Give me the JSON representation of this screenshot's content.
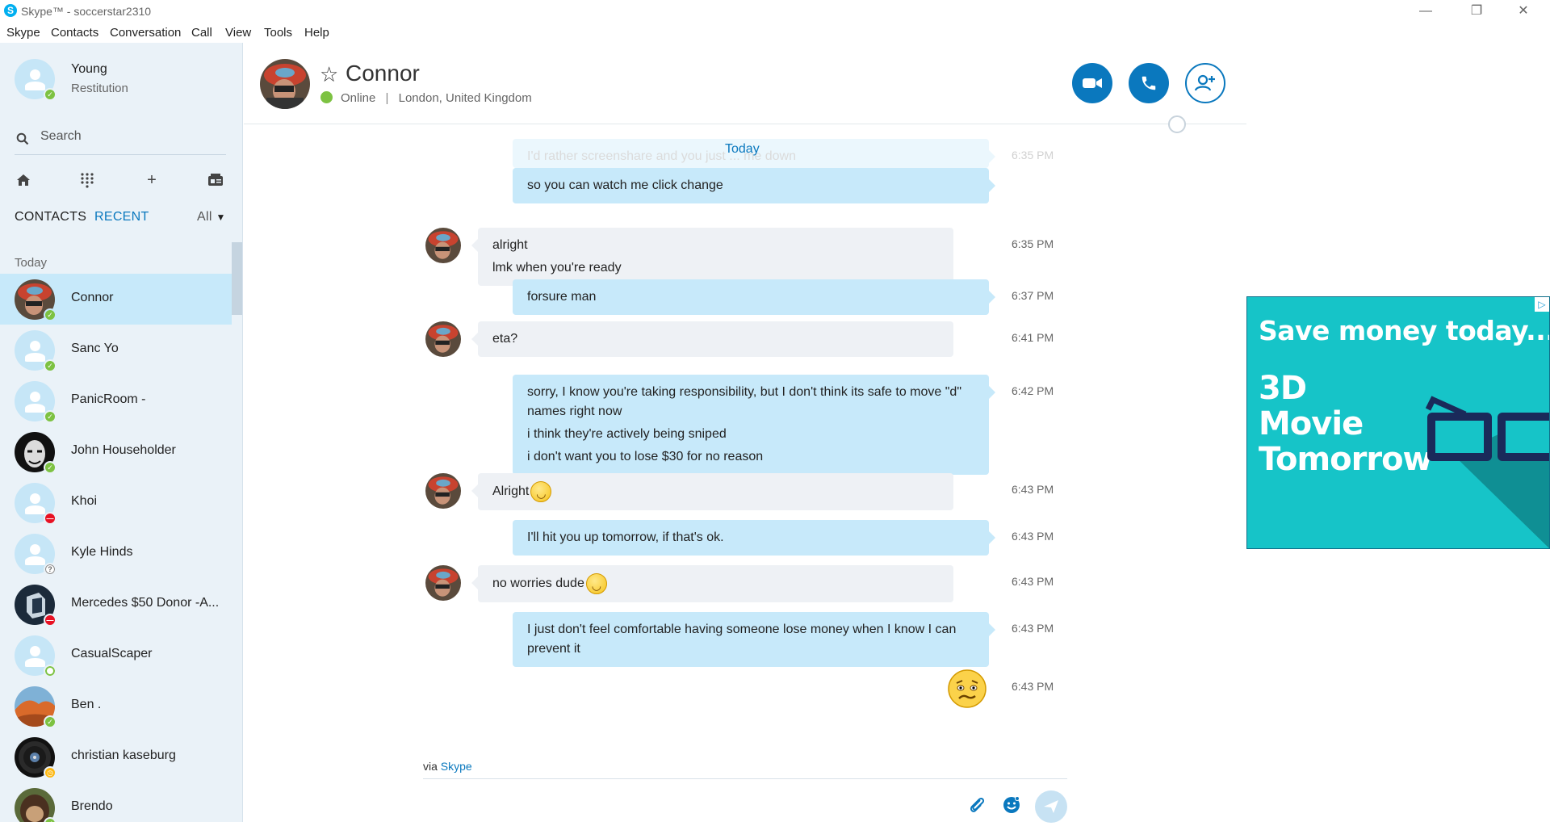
{
  "window": {
    "title": "Skype™ - soccerstar2310"
  },
  "menu": [
    "Skype",
    "Contacts",
    "Conversation",
    "Call",
    "View",
    "Tools",
    "Help"
  ],
  "me": {
    "name": "Young",
    "mood": "Restitution",
    "status": "online"
  },
  "search": {
    "label": "Search"
  },
  "tabs": {
    "contacts": "CONTACTS",
    "recent": "RECENT",
    "filter": "All"
  },
  "section": "Today",
  "contacts": [
    {
      "name": "Connor",
      "status": "online",
      "active": true,
      "photo": "helmet"
    },
    {
      "name": "Sanc Yo",
      "status": "online"
    },
    {
      "name": "PanicRoom -",
      "status": "online"
    },
    {
      "name": "John Householder",
      "status": "online",
      "photo": "mask"
    },
    {
      "name": "Khoi",
      "status": "dnd"
    },
    {
      "name": "Kyle Hinds",
      "status": "unknown"
    },
    {
      "name": "Mercedes $50 Donor -A...",
      "status": "dnd",
      "photo": "dark-cube"
    },
    {
      "name": "CasualScaper",
      "status": "offline"
    },
    {
      "name": "Ben .",
      "status": "online",
      "photo": "orange-rock"
    },
    {
      "name": "christian kaseburg",
      "status": "away",
      "photo": "vinyl"
    },
    {
      "name": "Brendo",
      "status": "online",
      "photo": "monkey"
    }
  ],
  "header": {
    "name": "Connor",
    "presence": "Online",
    "location": "London, United Kingdom"
  },
  "thread": {
    "day_label": "Today",
    "faded": {
      "text": "I'd rather screenshare and you just ... me down",
      "time": "6:35 PM"
    },
    "messages": [
      {
        "dir": "out",
        "lines": [
          "so you can watch me click change"
        ],
        "time": ""
      },
      {
        "dir": "in",
        "lines": [
          "alright",
          "lmk when you're ready"
        ],
        "time": "6:35 PM"
      },
      {
        "dir": "out",
        "lines": [
          "forsure man"
        ],
        "time": "6:37 PM"
      },
      {
        "dir": "in",
        "lines": [
          "eta?"
        ],
        "time": "6:41 PM"
      },
      {
        "dir": "out",
        "lines": [
          "sorry, I know you're taking responsibility, but I don't think its safe to move \"d\" names right now",
          "i think they're actively being sniped",
          "i don't want you to lose $30 for no reason"
        ],
        "time": "6:42 PM"
      },
      {
        "dir": "in",
        "lines": [
          "Alright"
        ],
        "emoji": "smile",
        "time": "6:43 PM"
      },
      {
        "dir": "out",
        "lines": [
          "I'll hit you up tomorrow, if that's ok."
        ],
        "time": "6:43 PM"
      },
      {
        "dir": "in",
        "lines": [
          "no worries dude"
        ],
        "emoji": "smile",
        "time": "6:43 PM"
      },
      {
        "dir": "out",
        "lines": [
          "I just don't feel comfortable having someone lose money when I know I can prevent it"
        ],
        "time": "6:43 PM"
      },
      {
        "dir": "out-emoji",
        "emoji": "worried",
        "time": "6:43 PM"
      }
    ]
  },
  "compose": {
    "via_prefix": "via",
    "via_link": "Skype"
  },
  "ad": {
    "headline": "Save money today...",
    "lines": [
      "3D",
      "Movie",
      "Tomorrow"
    ]
  },
  "colors": {
    "accent": "#0a78be",
    "online": "#7dc242",
    "dnd": "#e81123",
    "bubble_out": "#c7e9fa",
    "bubble_in": "#eef1f5",
    "ad_bg": "#16c4c8"
  }
}
